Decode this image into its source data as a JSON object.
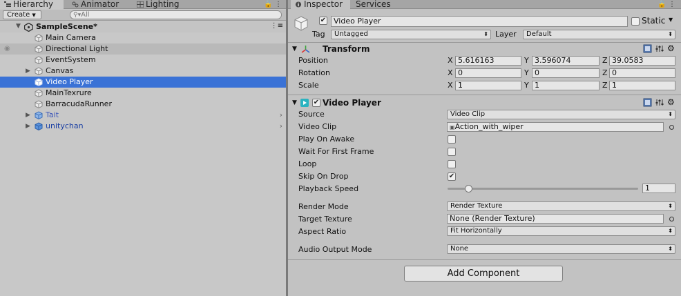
{
  "hierarchy": {
    "tabs": [
      {
        "label": "Hierarchy",
        "icon": "hierarchy-icon"
      },
      {
        "label": "Animator",
        "icon": "animator-icon"
      },
      {
        "label": "Lighting",
        "icon": "lighting-icon"
      }
    ],
    "create_label": "Create",
    "search_placeholder": "All",
    "scene_name": "SampleScene*",
    "items": [
      {
        "label": "Main Camera"
      },
      {
        "label": "Directional Light"
      },
      {
        "label": "EventSystem"
      },
      {
        "label": "Canvas"
      },
      {
        "label": "Video Player"
      },
      {
        "label": "MainTexrure"
      },
      {
        "label": "BarracudaRunner"
      },
      {
        "label": "Tait"
      },
      {
        "label": "unitychan"
      }
    ]
  },
  "inspector": {
    "tabs": [
      {
        "label": "Inspector",
        "icon": "info-icon"
      },
      {
        "label": "Services"
      }
    ],
    "object_name": "Video Player",
    "static_label": "Static",
    "tag_label": "Tag",
    "tag_value": "Untagged",
    "layer_label": "Layer",
    "layer_value": "Default",
    "transform": {
      "title": "Transform",
      "position_label": "Position",
      "rotation_label": "Rotation",
      "scale_label": "Scale",
      "axis_x": "X",
      "axis_y": "Y",
      "axis_z": "Z",
      "position": {
        "x": "5.616163",
        "y": "3.596074",
        "z": "39.0583"
      },
      "rotation": {
        "x": "0",
        "y": "0",
        "z": "0"
      },
      "scale": {
        "x": "1",
        "y": "1",
        "z": "1"
      }
    },
    "video_player": {
      "title": "Video Player",
      "source_label": "Source",
      "source_value": "Video Clip",
      "video_clip_label": "Video Clip",
      "video_clip_value": "Action_with_wiper",
      "play_on_awake_label": "Play On Awake",
      "wait_first_frame_label": "Wait For First Frame",
      "loop_label": "Loop",
      "skip_on_drop_label": "Skip On Drop",
      "playback_speed_label": "Playback Speed",
      "playback_speed_value": "1",
      "playback_speed_fraction": 0.11,
      "render_mode_label": "Render Mode",
      "render_mode_value": "Render Texture",
      "target_texture_label": "Target Texture",
      "target_texture_value": "None (Render Texture)",
      "aspect_ratio_label": "Aspect Ratio",
      "aspect_ratio_value": "Fit Horizontally",
      "audio_output_label": "Audio Output Mode",
      "audio_output_value": "None"
    },
    "add_component_label": "Add Component"
  },
  "colors": {
    "selection": "#3a72d6",
    "prefab_text": "#1a3fa3",
    "video_icon": "#2bb3c0"
  }
}
